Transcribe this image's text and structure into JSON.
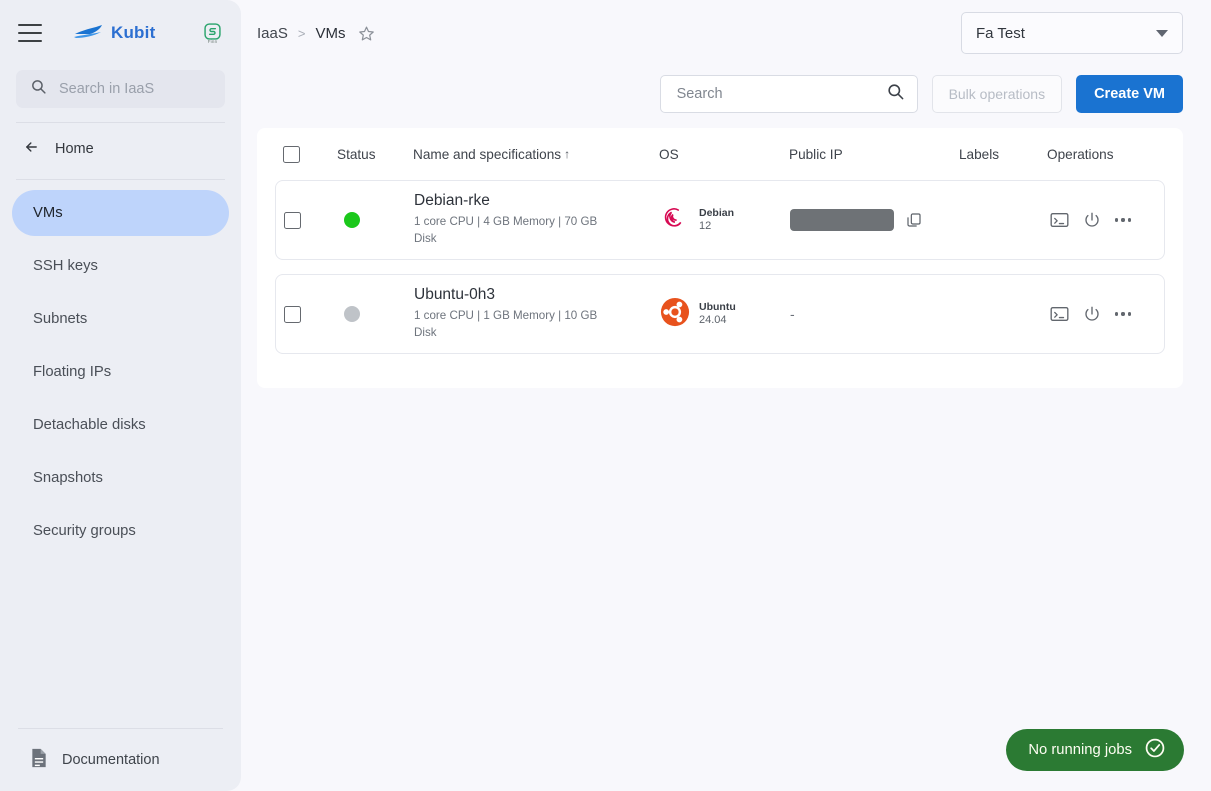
{
  "sidebar": {
    "menu_icon": "hamburger-icon",
    "brand": "Kubit",
    "brand_mark": "boat-logo-icon",
    "s_badge": "s-logo-icon",
    "s_badge_sub": "Finn",
    "search": {
      "placeholder": "Search in IaaS",
      "value": "",
      "icon": "search-icon"
    },
    "home": {
      "label": "Home",
      "icon": "arrow-left-icon"
    },
    "items": [
      {
        "label": "VMs",
        "active": true
      },
      {
        "label": "SSH keys",
        "active": false
      },
      {
        "label": "Subnets",
        "active": false
      },
      {
        "label": "Floating IPs",
        "active": false
      },
      {
        "label": "Detachable disks",
        "active": false
      },
      {
        "label": "Snapshots",
        "active": false
      },
      {
        "label": "Security groups",
        "active": false
      }
    ],
    "documentation": {
      "label": "Documentation",
      "icon": "document-icon"
    }
  },
  "header": {
    "breadcrumb": {
      "root": "IaaS",
      "separator": ">",
      "current": "VMs",
      "star_icon": "star-outline-icon"
    },
    "project_select": {
      "value": "Fa Test",
      "icon": "chevron-down-icon"
    }
  },
  "toolbar": {
    "search": {
      "placeholder": "Search",
      "value": "",
      "icon": "search-icon"
    },
    "bulk_operations": {
      "label": "Bulk operations",
      "disabled": true
    },
    "create_vm": {
      "label": "Create VM"
    }
  },
  "table": {
    "columns": [
      {
        "key": "select",
        "label": ""
      },
      {
        "key": "status",
        "label": "Status"
      },
      {
        "key": "name",
        "label": "Name and specifications",
        "sort": "↑"
      },
      {
        "key": "os",
        "label": "OS"
      },
      {
        "key": "public_ip",
        "label": "Public IP"
      },
      {
        "key": "labels",
        "label": "Labels"
      },
      {
        "key": "operations",
        "label": "Operations"
      }
    ],
    "rows": [
      {
        "selected": false,
        "status": "running",
        "name": "Debian-rke",
        "specs": "1 core CPU | 4 GB Memory | 70 GB Disk",
        "os_icon": "debian-icon",
        "os_name": "Debian",
        "os_version": "12",
        "public_ip": "redacted",
        "public_ip_copy_icon": "copy-icon",
        "labels": "",
        "operations": [
          "console-icon",
          "power-icon",
          "more-options-icon"
        ]
      },
      {
        "selected": false,
        "status": "stopped",
        "name": "Ubuntu-0h3",
        "specs": "1 core CPU | 1 GB Memory | 10 GB Disk",
        "os_icon": "ubuntu-icon",
        "os_name": "Ubuntu",
        "os_version": "24.04",
        "public_ip": "-",
        "labels": "",
        "operations": [
          "console-icon",
          "power-icon",
          "more-options-icon"
        ]
      }
    ]
  },
  "jobs_status": {
    "label": "No running jobs",
    "icon": "check-circle-icon"
  },
  "colors": {
    "accent": "#1a73d1",
    "sidebar_bg": "#eceef4",
    "active_item": "#bed4fb",
    "page_bg": "#f8f8fc",
    "status_running": "#1bc81b",
    "status_stopped": "#bfc3c8",
    "jobs_pill": "#2b7a33",
    "debian": "#d70a53",
    "ubuntu": "#e8521d"
  }
}
